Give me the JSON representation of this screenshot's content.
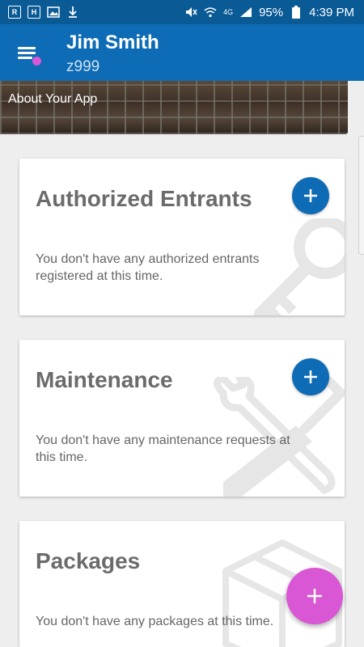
{
  "status_bar": {
    "battery": "95%",
    "time": "4:39 PM",
    "network": "4G"
  },
  "header": {
    "user_name": "Jim Smith",
    "user_id": "z999"
  },
  "banner": {
    "label": "About Your App"
  },
  "cards": [
    {
      "title": "Authorized Entrants",
      "message": "You don't have any authorized entrants registered at this time.",
      "icon": "key-icon"
    },
    {
      "title": "Maintenance",
      "message": "You don't have any maintenance requests at this time.",
      "icon": "tools-icon"
    },
    {
      "title": "Packages",
      "message": "You don't have any packages at this time.",
      "icon": "box-icon"
    }
  ],
  "colors": {
    "primary": "#0d6cb5",
    "status_bar": "#0a5a96",
    "accent": "#d957d4",
    "background": "#eeeeee"
  }
}
